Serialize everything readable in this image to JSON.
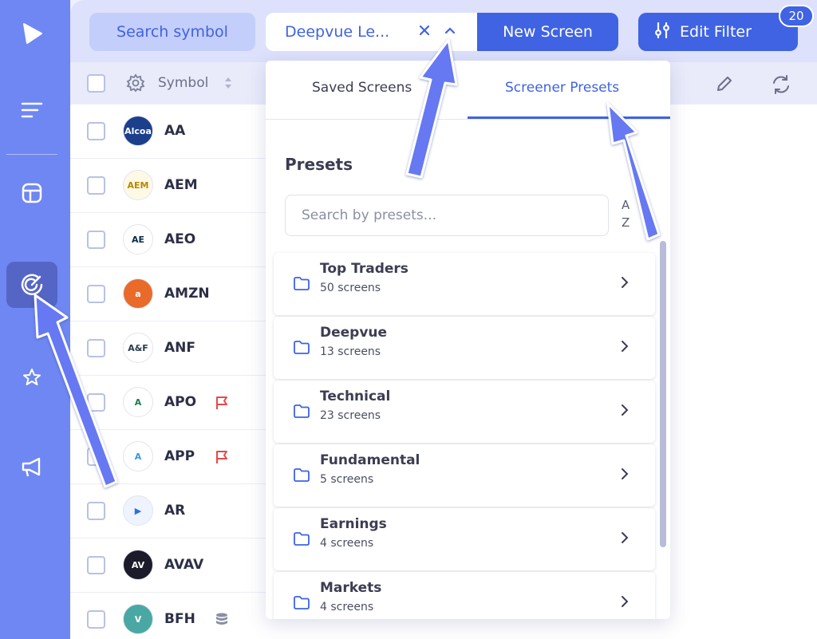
{
  "toolbar": {
    "search_symbol_label": "Search symbol",
    "screen_name": "Deepvue Le...",
    "new_screen_label": "New Screen",
    "edit_filter_label": "Edit Filter",
    "filter_count": "20"
  },
  "table": {
    "symbol_header": "Symbol",
    "rows": [
      {
        "symbol": "AA",
        "logo_text": "Alcoa",
        "logo_bg": "#1c3f8c",
        "logo_fg": "#ffffff",
        "flag": ""
      },
      {
        "symbol": "AEM",
        "logo_text": "AEM",
        "logo_bg": "#fef9e6",
        "logo_fg": "#b48a00",
        "flag": ""
      },
      {
        "symbol": "AEO",
        "logo_text": "AE",
        "logo_bg": "#ffffff",
        "logo_fg": "#0a2a4a",
        "flag": ""
      },
      {
        "symbol": "AMZN",
        "logo_text": "a",
        "logo_bg": "#ea6a2a",
        "logo_fg": "#ffffff",
        "flag": ""
      },
      {
        "symbol": "ANF",
        "logo_text": "A&F",
        "logo_bg": "#ffffff",
        "logo_fg": "#2a3a4a",
        "flag": ""
      },
      {
        "symbol": "APO",
        "logo_text": "A",
        "logo_bg": "#ffffff",
        "logo_fg": "#1e7b4f",
        "flag": "flag"
      },
      {
        "symbol": "APP",
        "logo_text": "A",
        "logo_bg": "#ffffff",
        "logo_fg": "#3a9ad6",
        "flag": "flag"
      },
      {
        "symbol": "AR",
        "logo_text": "▶",
        "logo_bg": "#eef3fd",
        "logo_fg": "#2f6fe0",
        "flag": ""
      },
      {
        "symbol": "AVAV",
        "logo_text": "AV",
        "logo_bg": "#1b1b2a",
        "logo_fg": "#ffffff",
        "flag": ""
      },
      {
        "symbol": "BFH",
        "logo_text": "V",
        "logo_bg": "#4aa8a4",
        "logo_fg": "#ffffff",
        "flag": "db"
      }
    ]
  },
  "panel": {
    "tabs": [
      {
        "label": "Saved Screens",
        "active": false
      },
      {
        "label": "Screener Presets",
        "active": true
      }
    ],
    "section_title": "Presets",
    "search_placeholder": "Search by presets...",
    "sort_top": "A",
    "sort_bottom": "Z",
    "items": [
      {
        "name": "Top Traders",
        "count": "50 screens"
      },
      {
        "name": "Deepvue",
        "count": "13 screens"
      },
      {
        "name": "Technical",
        "count": "23 screens"
      },
      {
        "name": "Fundamental",
        "count": "5 screens"
      },
      {
        "name": "Earnings",
        "count": "4 screens"
      },
      {
        "name": "Markets",
        "count": "4 screens"
      }
    ]
  },
  "icons": {
    "rail": [
      "logo-play-icon",
      "menu-lines-icon",
      "layout-icon",
      "screener-target-icon",
      "star-icon",
      "megaphone-icon"
    ],
    "colors": {
      "accent": "#3f63e3",
      "rail": "#6f87f2",
      "flag": "#e24b4b"
    }
  }
}
